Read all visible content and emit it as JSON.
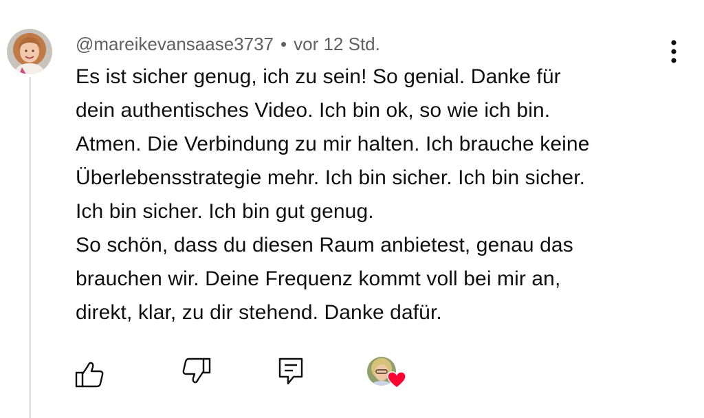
{
  "comment": {
    "author": "@mareikevansaase3737",
    "separator": "•",
    "time": "vor 12 Std.",
    "lines": [
      "Es ist sicher genug, ich zu sein! So genial. Danke für",
      "dein authentisches Video. Ich bin ok, so wie ich bin.",
      "Atmen. Die Verbindung zu mir halten. Ich brauche keine",
      "Überlebensstrategie mehr. Ich bin sicher. Ich bin sicher.",
      "Ich bin sicher. Ich bin gut genug.",
      "So schön, dass du diesen Raum anbietest, genau das",
      "brauchen wir. Deine Frequenz kommt voll bei mir an,",
      "direkt, klar, zu dir stehend. Danke dafür."
    ]
  },
  "icons": {
    "more": "more-vert-icon",
    "like": "thumbs-up-icon",
    "dislike": "thumbs-down-icon",
    "reply": "reply-comment-icon",
    "creator_heart": "heart-icon"
  },
  "colors": {
    "text": "#0f0f0f",
    "secondary_text": "#606060",
    "thread_line": "#e5e5e5",
    "heart": "#ff0033"
  }
}
